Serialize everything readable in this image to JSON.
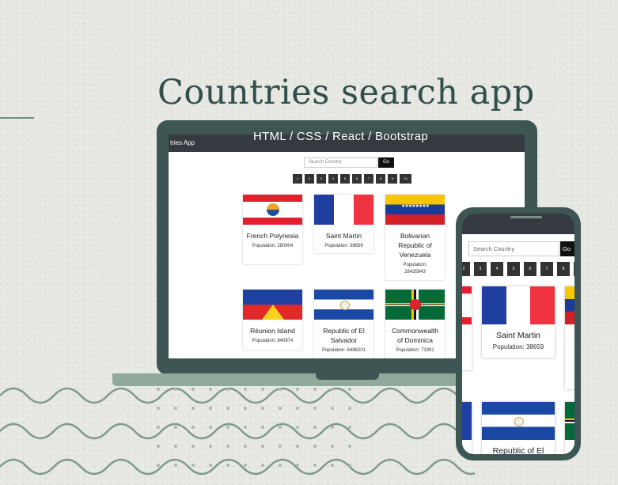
{
  "headline": "Countries search app",
  "tech_stack": "HTML / CSS / React / Bootstrap",
  "laptop": {
    "brand": "tries App",
    "search_placeholder": "Search Country",
    "go_label": "Go",
    "pages": [
      "1",
      "2",
      "3",
      "4",
      "5",
      "6",
      "7",
      "8",
      "9",
      "10"
    ],
    "cards": [
      {
        "name": "French Polynesia",
        "population": "Population: 280904"
      },
      {
        "name": "Saint Martin",
        "population": "Population: 38659"
      },
      {
        "name": "Bolivarian Republic of Venezuela",
        "population": "Population: 28435943"
      },
      {
        "name": "Réunion Island",
        "population": "Population: 840974"
      },
      {
        "name": "Republic of El Salvador",
        "population": "Population: 6486201"
      },
      {
        "name": "Commonwealth of Dominica",
        "population": "Population: 71991"
      }
    ]
  },
  "phone": {
    "search_placeholder": "Search Country",
    "go_label": "Go",
    "pages": [
      "2",
      "3",
      "4",
      "5",
      "6",
      "7",
      "8"
    ],
    "card": {
      "name": "Saint Martin",
      "population": "Population: 38659"
    },
    "card2_name": "Republic of El"
  },
  "colors": {
    "frame": "#3d5553",
    "title": "#2f4f4a",
    "accent": "#8fa99a"
  }
}
